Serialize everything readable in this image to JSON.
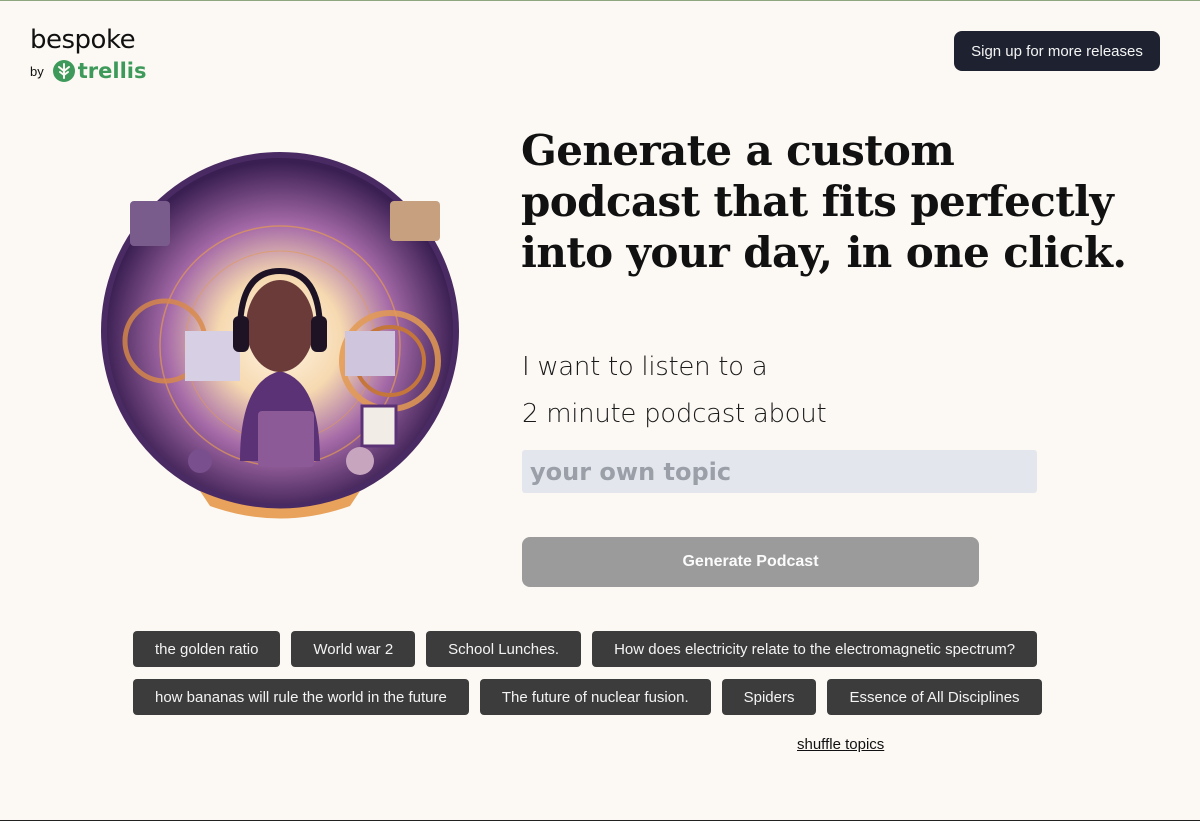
{
  "brand": {
    "name": "bespoke",
    "by_label": "by",
    "partner": "trellis",
    "partner_color": "#3e9a5a"
  },
  "header": {
    "signup_label": "Sign up for more releases"
  },
  "hero": {
    "headline": "Generate a custom podcast that fits perfectly into your day, in one click.",
    "line_1": "I want to listen to a",
    "line_2": "2 minute podcast about",
    "topic_placeholder": "your own topic",
    "generate_label": "Generate Podcast",
    "illustration_icon": "podcast-listener-illustration"
  },
  "topics": {
    "row_1": [
      "the golden ratio",
      "World war 2",
      "School Lunches.",
      "How does electricity relate to the electromagnetic spectrum?"
    ],
    "row_2": [
      "how bananas will rule the world in the future",
      "The future of nuclear fusion.",
      "Spiders",
      "Essence of All Disciplines"
    ],
    "shuffle_label": "shuffle topics"
  },
  "colors": {
    "background": "#fcf9f4",
    "dark_button": "#1e2230",
    "chip": "#3c3c3c",
    "disabled_button": "#9b9b9b",
    "input_bg": "#e3e6ed",
    "illustration_purple": "#4a2a63",
    "illustration_orange": "#e39a52"
  }
}
